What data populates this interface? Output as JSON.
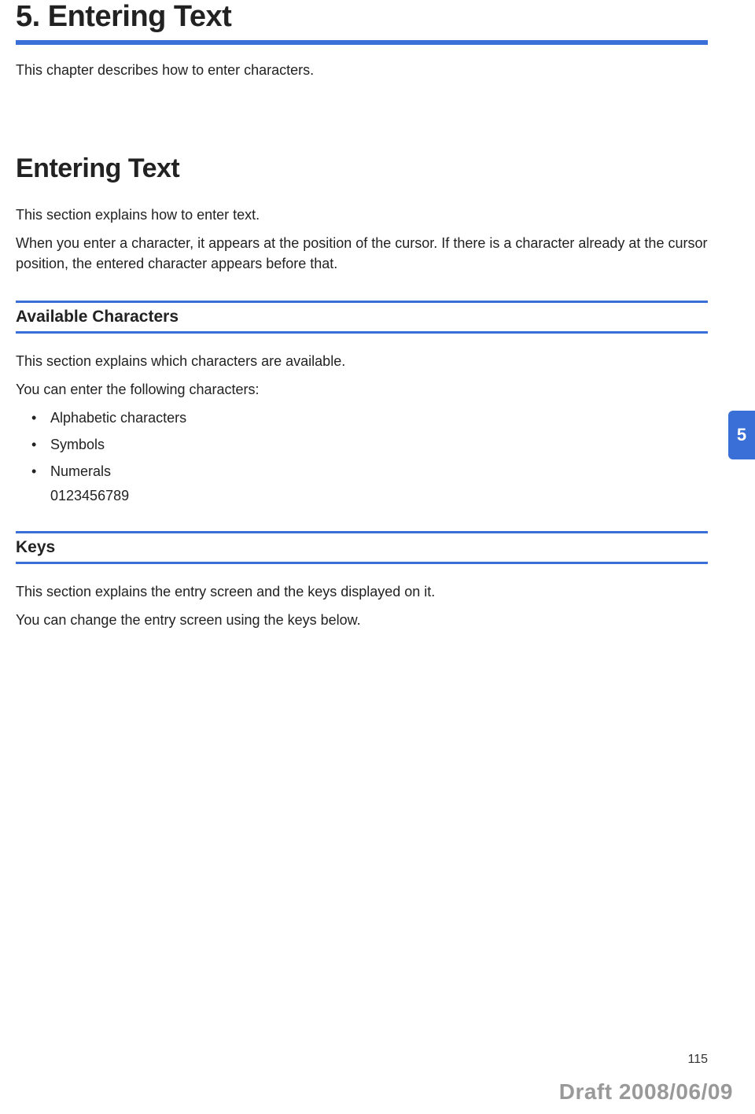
{
  "chapter": {
    "title": "5. Entering Text",
    "intro": "This chapter describes how to enter characters."
  },
  "section": {
    "title": "Entering Text",
    "p1": "This section explains how to enter text.",
    "p2": "When you enter a character, it appears at the position of the cursor. If there is a character already at the cursor position, the entered character appears before that."
  },
  "subsection_available": {
    "title": "Available Characters",
    "p1": "This section explains which characters are available.",
    "p2": "You can enter the following characters:",
    "bullets": {
      "b0": "Alphabetic characters",
      "b1": "Symbols",
      "b2": "Numerals"
    },
    "numerals_sample": "0123456789"
  },
  "subsection_keys": {
    "title": "Keys",
    "p1": "This section explains the entry screen and the keys displayed on it.",
    "p2": "You can change the entry screen using the keys below."
  },
  "side_tab": "5",
  "page_number": "115",
  "draft": "Draft 2008/06/09"
}
